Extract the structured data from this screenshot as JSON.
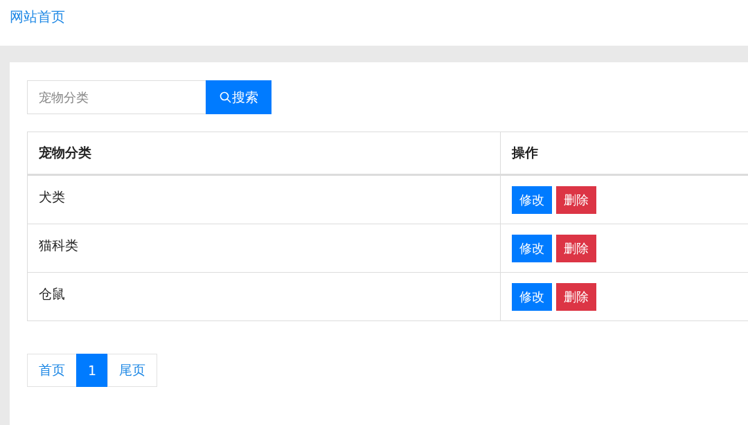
{
  "header": {
    "home_link": "网站首页"
  },
  "search": {
    "placeholder": "宠物分类",
    "button": "搜索"
  },
  "table": {
    "columns": [
      "宠物分类",
      "操作"
    ],
    "rows": [
      {
        "category": "犬类",
        "actions": [
          {
            "label": "修改",
            "kind": "edit"
          },
          {
            "label": "删除",
            "kind": "delete"
          }
        ]
      },
      {
        "category": "猫科类",
        "actions": [
          {
            "label": "修改",
            "kind": "edit"
          },
          {
            "label": "删除",
            "kind": "delete"
          }
        ]
      },
      {
        "category": "仓鼠",
        "actions": [
          {
            "label": "修改",
            "kind": "edit"
          },
          {
            "label": "删除",
            "kind": "delete"
          }
        ]
      }
    ]
  },
  "pagination": [
    {
      "label": "首页",
      "selected": false
    },
    {
      "label": "1",
      "selected": true
    },
    {
      "label": "尾页",
      "selected": false
    }
  ]
}
